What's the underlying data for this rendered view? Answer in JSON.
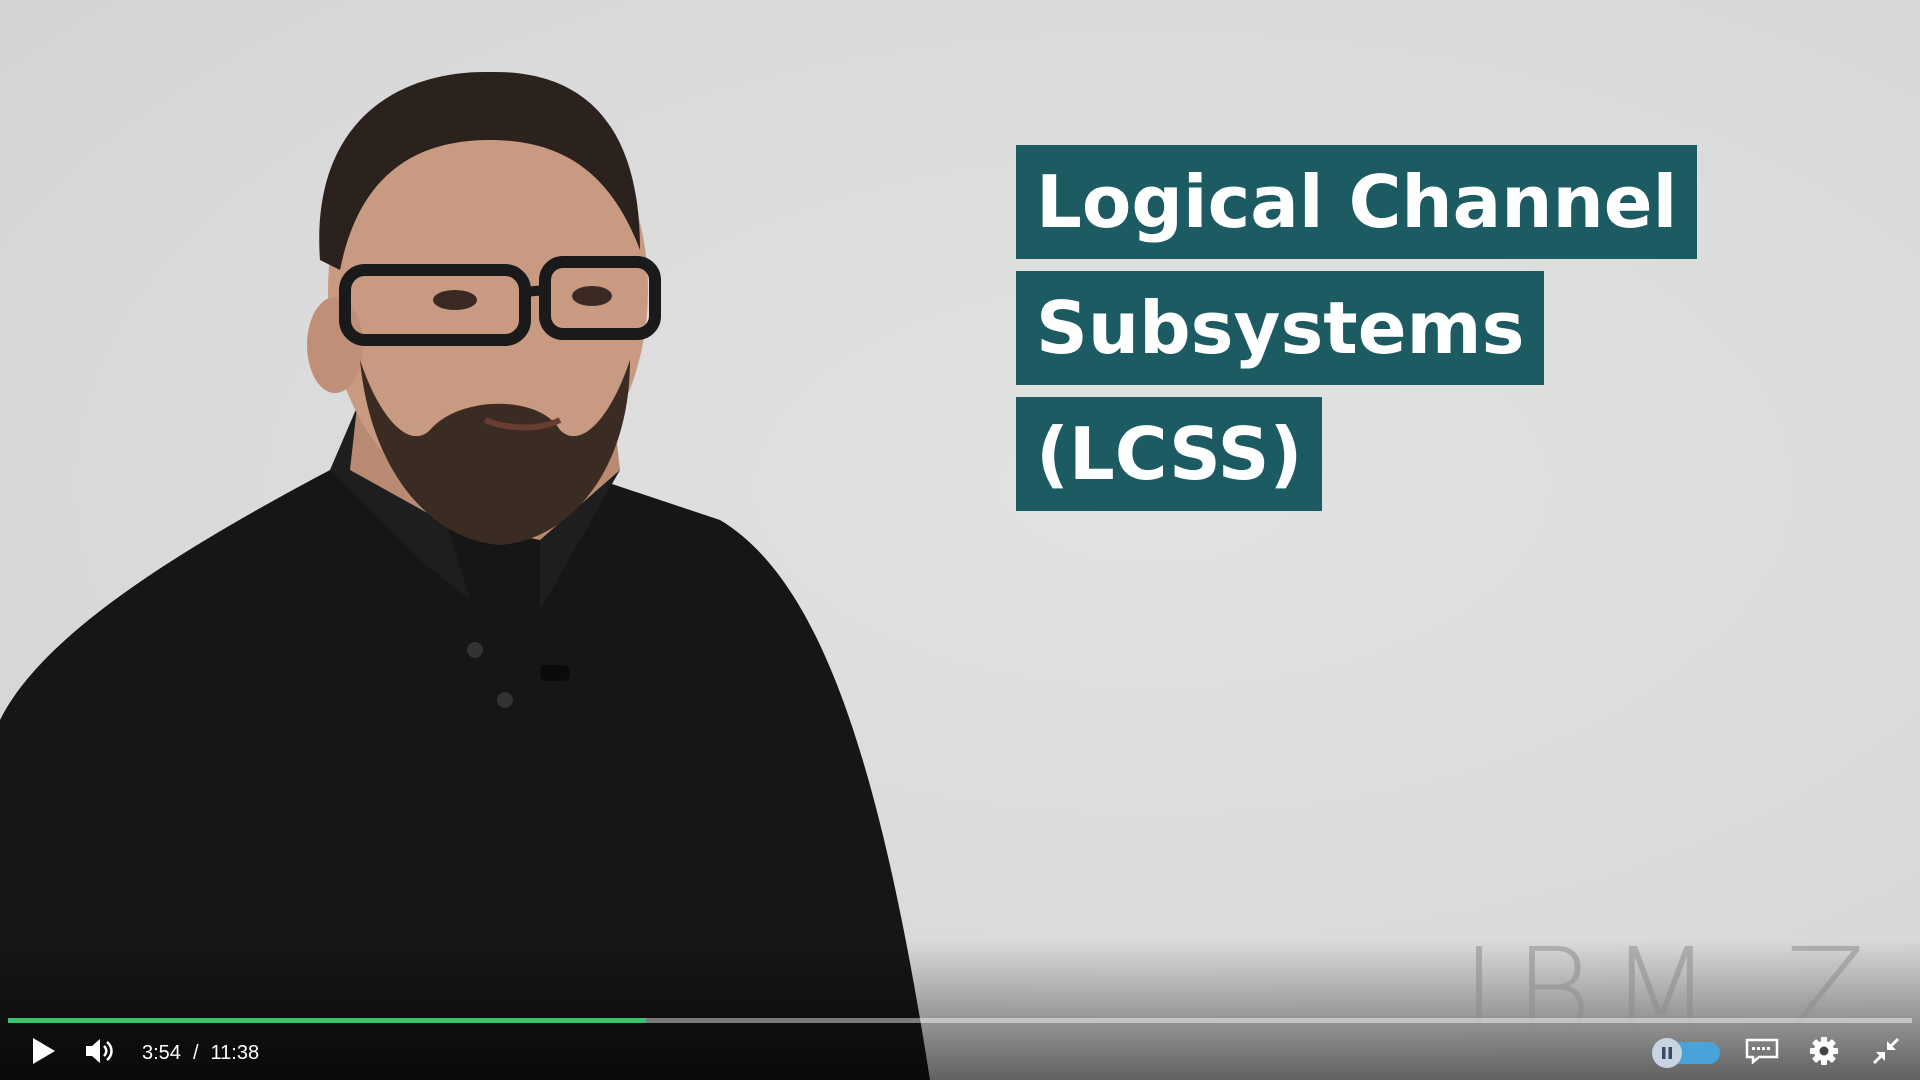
{
  "video": {
    "title_lines": [
      "Logical Channel",
      "Subsystems",
      "(LCSS)"
    ],
    "watermark": "IBM Z",
    "title_box_color": "#1c5b61"
  },
  "player": {
    "current_time": "3:54",
    "separator": "/",
    "duration": "11:38",
    "progress_fraction": 0.3352,
    "progress_color": "#3ac36f"
  },
  "icons": {
    "play": "play-icon",
    "volume": "volume-icon",
    "autoplay_toggle": "pause-toggle-icon",
    "captions": "captions-icon",
    "settings": "gear-icon",
    "exit_fullscreen": "exit-fullscreen-icon"
  }
}
